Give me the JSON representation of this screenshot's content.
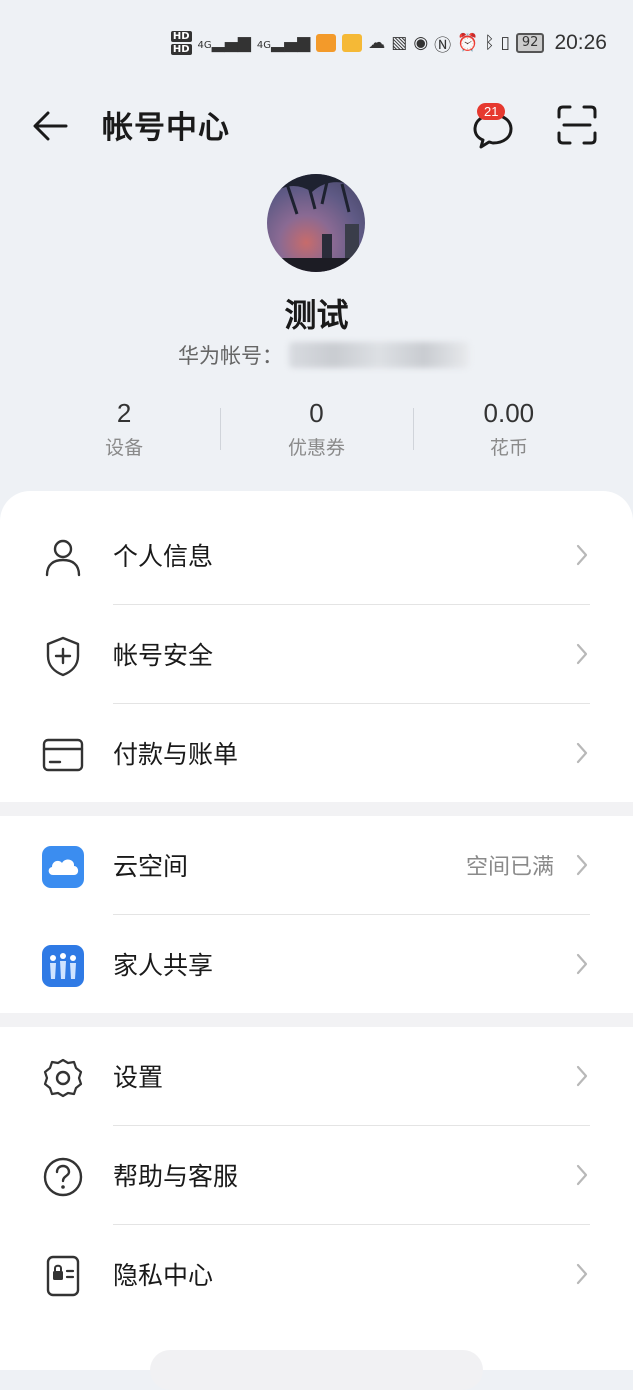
{
  "status_bar": {
    "hd_top": "HD",
    "hd_bottom": "HD",
    "signal_1": "4G",
    "signal_2": "4G",
    "battery": "92",
    "time": "20:26"
  },
  "header": {
    "title": "帐号中心",
    "message_badge": "21"
  },
  "profile": {
    "name": "测试",
    "account_label": "华为帐号："
  },
  "stats": [
    {
      "value": "2",
      "label": "设备"
    },
    {
      "value": "0",
      "label": "优惠券"
    },
    {
      "value": "0.00",
      "label": "花币"
    }
  ],
  "menu": {
    "group1": [
      {
        "label": "个人信息",
        "icon": "person-icon"
      },
      {
        "label": "帐号安全",
        "icon": "shield-icon"
      },
      {
        "label": "付款与账单",
        "icon": "card-icon"
      }
    ],
    "group2": [
      {
        "label": "云空间",
        "value": "空间已满",
        "icon": "cloud-icon"
      },
      {
        "label": "家人共享",
        "icon": "family-icon"
      }
    ],
    "group3": [
      {
        "label": "设置",
        "icon": "gear-icon"
      },
      {
        "label": "帮助与客服",
        "icon": "help-icon"
      },
      {
        "label": "隐私中心",
        "icon": "privacy-icon"
      }
    ]
  },
  "colors": {
    "background": "#eef1f5",
    "badge": "#e6392f",
    "cloud_blue": "#3b8df0"
  }
}
